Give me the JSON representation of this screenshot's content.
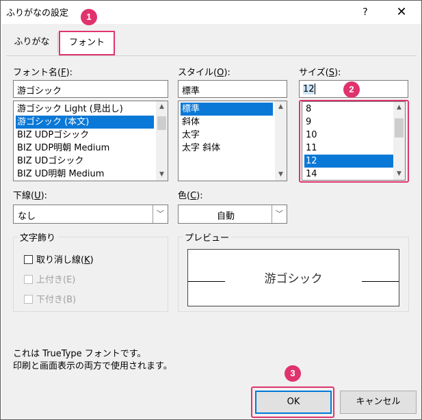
{
  "window": {
    "title": "ふりがなの設定",
    "help_icon": "?",
    "close_icon": "✕"
  },
  "tabs": [
    {
      "label": "ふりがな"
    },
    {
      "label": "フォント"
    }
  ],
  "font_name": {
    "label_pre": "フォント名(",
    "label_key": "F",
    "label_post": "):",
    "value": "游ゴシック",
    "items": [
      "游ゴシック Light (見出し)",
      "游ゴシック (本文)",
      "BIZ UDPゴシック",
      "BIZ UDP明朝 Medium",
      "BIZ UDゴシック",
      "BIZ UD明朝 Medium"
    ],
    "selected_index": 1
  },
  "style": {
    "label_pre": "スタイル(",
    "label_key": "O",
    "label_post": "):",
    "value": "標準",
    "items": [
      "標準",
      "斜体",
      "太字",
      "太字 斜体"
    ],
    "selected_index": 0
  },
  "size": {
    "label_pre": "サイズ(",
    "label_key": "S",
    "label_post": "):",
    "value": "12",
    "items": [
      "8",
      "9",
      "10",
      "11",
      "12",
      "14"
    ],
    "selected_index": 4
  },
  "underline": {
    "label_pre": "下線(",
    "label_key": "U",
    "label_post": "):",
    "value": "なし"
  },
  "color": {
    "label_pre": "色(",
    "label_key": "C",
    "label_post": "):",
    "value": "自動"
  },
  "effects": {
    "legend": "文字飾り",
    "strikethrough_pre": "取り消し線(",
    "strikethrough_key": "K",
    "strikethrough_post": ")",
    "superscript": "上付き(E)",
    "subscript": "下付き(B)"
  },
  "preview": {
    "legend": "プレビュー",
    "sample": "游ゴシック"
  },
  "info": {
    "line1": "これは TrueType フォントです。",
    "line2": "印刷と画面表示の両方で使用されます。"
  },
  "buttons": {
    "ok": "OK",
    "cancel": "キャンセル"
  },
  "annotations": {
    "badge1": "1",
    "badge2": "2",
    "badge3": "3",
    "color": "#e0336d"
  },
  "scroll": {
    "up_icon": "▲",
    "down_icon": "▼",
    "combo_icon": "﹀"
  }
}
